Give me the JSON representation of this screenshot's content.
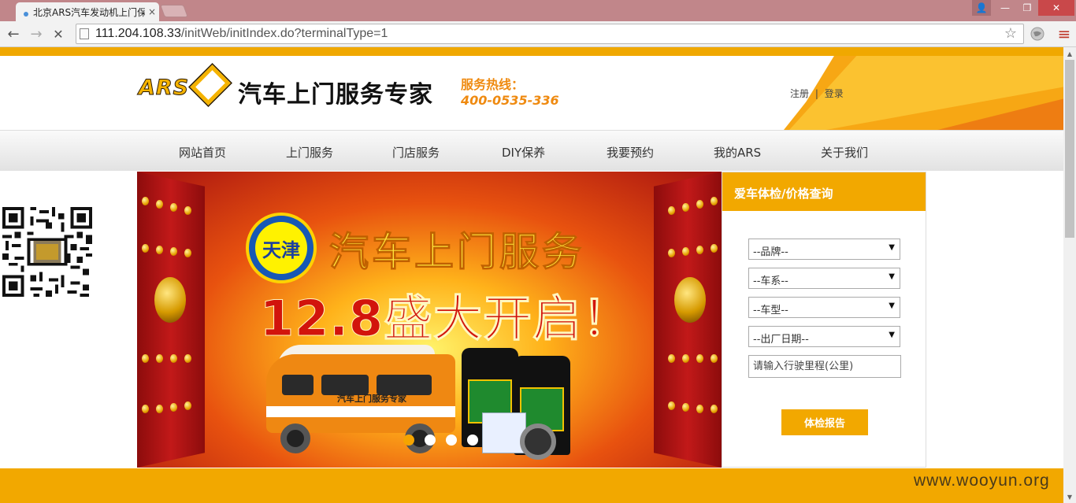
{
  "browser": {
    "tab_title": "北京ARS汽车发动机上门保",
    "tab_close": "×",
    "url_host": "111.204.108.33",
    "url_path": "/initWeb/initIndex.do?terminalType=1",
    "back_glyph": "←",
    "forward_glyph": "→",
    "stop_glyph": "✕",
    "star_glyph": "☆",
    "menu_glyph": "≡",
    "user_glyph": "👤",
    "min_glyph": "—",
    "max_glyph": "❐",
    "close_glyph": "✕"
  },
  "header": {
    "logo_text": "ARS",
    "slogan": "汽车上门服务专家",
    "hotline_label": "服务热线：",
    "hotline_number": "400-0535-336",
    "register": "注册",
    "separator": "|",
    "login": "登录"
  },
  "nav": {
    "items": [
      "网站首页",
      "上门服务",
      "门店服务",
      "DIY保养",
      "我要预约",
      "我的ARS",
      "关于我们"
    ]
  },
  "banner": {
    "city": "天津",
    "headline": "汽车上门服务",
    "date_line": "12.8盛大开启！",
    "van_text": "汽车上门服务专家",
    "slide_count": 4,
    "active_slide": 1
  },
  "check": {
    "title": "爱车体检/价格查询",
    "brand_select": "--品牌--",
    "series_select": "--车系--",
    "model_select": "--车型--",
    "date_select": "--出厂日期--",
    "mileage_placeholder": "请输入行驶里程(公里)",
    "report_button": "体检报告",
    "arrow": "▼"
  },
  "watermark": "www.wooyun.org",
  "colors": {
    "brand_orange": "#f2a800",
    "titlebar": "#c1868a",
    "hotline": "#ef8a10",
    "banner_red": "#d2140c"
  }
}
